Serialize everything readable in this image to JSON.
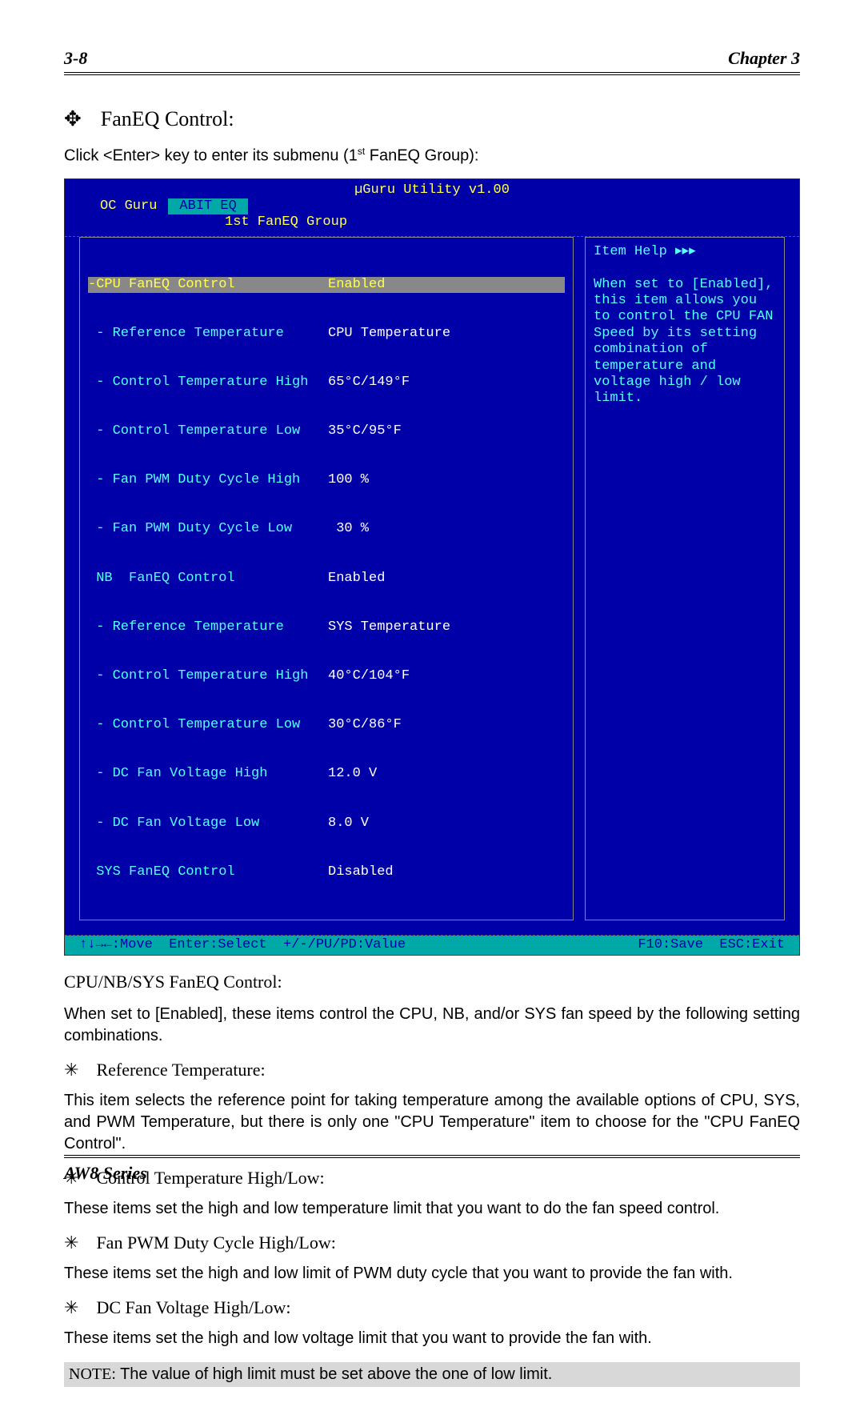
{
  "header": {
    "page": "3-8",
    "chapter": "Chapter 3"
  },
  "title": "FanEQ Control:",
  "intro_a": "Click <Enter> key to enter its submenu (1",
  "intro_sup": "st",
  "intro_b": " FanEQ Group):",
  "bios": {
    "title": "µGuru Utility v1.00",
    "tabs": {
      "oc": "OC Guru",
      "eq": "ABIT EQ"
    },
    "subhead": "1st FanEQ Group",
    "rows": [
      {
        "label": "-CPU FanEQ Control",
        "value": "Enabled",
        "highlight": true
      },
      {
        "label": " - Reference Temperature",
        "value": "CPU Temperature"
      },
      {
        "label": " - Control Temperature High",
        "value": "65°C/149°F"
      },
      {
        "label": " - Control Temperature Low",
        "value": "35°C/95°F"
      },
      {
        "label": " - Fan PWM Duty Cycle High",
        "value": "100 %"
      },
      {
        "label": " - Fan PWM Duty Cycle Low",
        "value": " 30 %"
      },
      {
        "label": " NB  FanEQ Control",
        "value": "Enabled"
      },
      {
        "label": " - Reference Temperature",
        "value": "SYS Temperature"
      },
      {
        "label": " - Control Temperature High",
        "value": "40°C/104°F"
      },
      {
        "label": " - Control Temperature Low",
        "value": "30°C/86°F"
      },
      {
        "label": " - DC Fan Voltage High",
        "value": "12.0 V"
      },
      {
        "label": " - DC Fan Voltage Low",
        "value": "8.0 V"
      },
      {
        "label": " SYS FanEQ Control",
        "value": "Disabled"
      }
    ],
    "help_title": "Item Help ▸▸▸",
    "help_body": "When set to [Enabled], this item allows you to control the CPU FAN Speed by its setting combination of temperature and voltage high / low limit.",
    "bar_left": "↑↓→←:Move  Enter:Select  +/-/PU/PD:Value",
    "bar_right": "F10:Save  ESC:Exit"
  },
  "section1": {
    "heading": "CPU/NB/SYS FanEQ Control:",
    "para": "When set to [Enabled], these items control the CPU, NB, and/or SYS fan speed by the following setting combinations."
  },
  "sub1": {
    "title": "Reference Temperature:",
    "para": "This item selects the reference point for taking temperature among the available options of CPU, SYS, and PWM Temperature, but there is only one \"CPU Temperature\" item to choose for the \"CPU FanEQ Control\"."
  },
  "sub2": {
    "title": "Control Temperature High/Low:",
    "para": "These items set the high and low temperature limit that you want to do the fan speed control."
  },
  "sub3": {
    "title": "Fan PWM Duty Cycle High/Low:",
    "para": "These items set the high and low limit of PWM duty cycle that you want to provide the fan with."
  },
  "sub4": {
    "title": "DC Fan Voltage High/Low:",
    "para": "These items set the high and low voltage limit that you want to provide the fan with."
  },
  "note": {
    "label": "NOTE:",
    "text": " The value of high limit must be set above the one of low limit."
  },
  "footer": "AW8 Series"
}
